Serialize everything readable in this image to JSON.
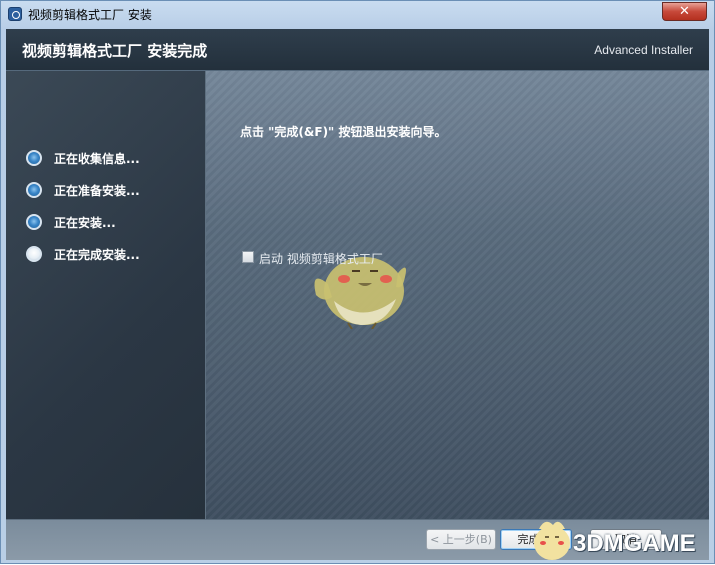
{
  "window": {
    "title": "视频剪辑格式工厂 安装",
    "close_glyph": "✕"
  },
  "header": {
    "title": "视频剪辑格式工厂 安装完成",
    "brand": "Advanced Installer"
  },
  "steps": [
    {
      "label": "正在收集信息...",
      "status": "done"
    },
    {
      "label": "正在准备安装...",
      "status": "done"
    },
    {
      "label": "正在安装...",
      "status": "done"
    },
    {
      "label": "正在完成安装...",
      "status": "current"
    }
  ],
  "main": {
    "instruction": "点击 \"完成(&F)\" 按钮退出安装向导。",
    "launch_checkbox": {
      "label": "启动 视频剪辑格式工厂",
      "checked": false
    }
  },
  "buttons": {
    "back": "< 上一步(B)",
    "finish": "完成(F)",
    "cancel": "取消"
  },
  "watermark": {
    "text": "3DMGAME"
  },
  "colors": {
    "header_bg": "#2b3845",
    "sidebar_bg": "#2f3b47",
    "step_done": "#3a86c8",
    "close_button": "#c7493a"
  },
  "icons": {
    "app": "installer-app-icon",
    "close": "close-icon",
    "step": "radio-dot-icon",
    "mascot": "bird-mascot-icon"
  }
}
